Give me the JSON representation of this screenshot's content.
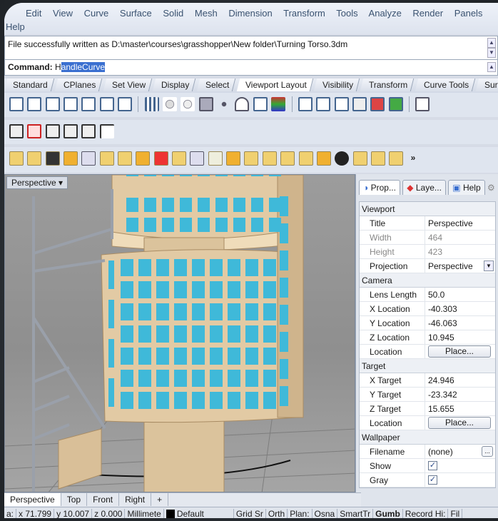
{
  "menu": {
    "items": [
      "Edit",
      "View",
      "Curve",
      "Surface",
      "Solid",
      "Mesh",
      "Dimension",
      "Transform",
      "Tools",
      "Analyze",
      "Render",
      "Panels"
    ],
    "wrapped": "Help"
  },
  "command": {
    "history": "File successfully written as D:\\master\\courses\\grasshopper\\New folder\\Turning Torso.3dm",
    "prompt": "Command:",
    "value_first": "H",
    "value_selected": "andleCurve"
  },
  "toolbar_tabs": [
    "Standard",
    "CPlanes",
    "Set View",
    "Display",
    "Select",
    "Viewport Layout",
    "Visibility",
    "Transform",
    "Curve Tools",
    "Surface T"
  ],
  "active_tab": "Viewport Layout",
  "more_tabs": "»",
  "viewport": {
    "title": "Perspective"
  },
  "viewport_tabs": [
    "Perspective",
    "Top",
    "Front",
    "Right"
  ],
  "add_tab": "+",
  "status": {
    "x": "x 71.799",
    "y": "y 10.007",
    "z": "z 0.000",
    "units": "Millimete",
    "layer": "Default",
    "toggles": [
      "Grid Sr",
      "Orth",
      "Plan:",
      "Osna",
      "SmartTr",
      "Gumb",
      "Record Hi:",
      "Fil"
    ],
    "cut": "a:"
  },
  "panel": {
    "tabs": [
      "Prop...",
      "Laye...",
      "Help"
    ],
    "sections": {
      "viewport": "Viewport",
      "camera": "Camera",
      "target": "Target",
      "wallpaper": "Wallpaper"
    },
    "viewport_rows": {
      "title_k": "Title",
      "title_v": "Perspective",
      "width_k": "Width",
      "width_v": "464",
      "height_k": "Height",
      "height_v": "423",
      "projection_k": "Projection",
      "projection_v": "Perspective"
    },
    "camera_rows": {
      "lens_k": "Lens Length",
      "lens_v": "50.0",
      "xloc_k": "X Location",
      "xloc_v": "-40.303",
      "yloc_k": "Y Location",
      "yloc_v": "-46.063",
      "zloc_k": "Z Location",
      "zloc_v": "10.945",
      "loc_k": "Location",
      "loc_btn": "Place..."
    },
    "target_rows": {
      "xt_k": "X Target",
      "xt_v": "24.946",
      "yt_k": "Y Target",
      "yt_v": "-23.342",
      "zt_k": "Z Target",
      "zt_v": "15.655",
      "loc_k": "Location",
      "loc_btn": "Place..."
    },
    "wallpaper_rows": {
      "file_k": "Filename",
      "file_v": "(none)",
      "file_btn": "...",
      "show_k": "Show",
      "gray_k": "Gray"
    },
    "checkmark": "✓"
  },
  "colors": {
    "building": "#e2caa4",
    "window": "#3fb9d9",
    "accent": "#3a6fd0"
  }
}
